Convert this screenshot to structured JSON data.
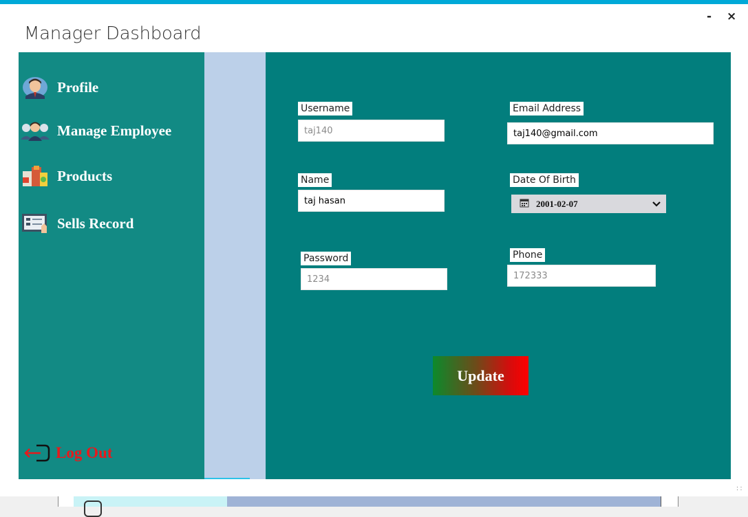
{
  "window": {
    "title": "Manager Dashboard",
    "minimize_label": "-",
    "close_label": "×"
  },
  "sidebar": {
    "items": [
      {
        "label": "Profile",
        "icon": "manager-avatar-icon"
      },
      {
        "label": "Manage Employee",
        "icon": "employees-group-icon"
      },
      {
        "label": "Products",
        "icon": "products-box-icon"
      },
      {
        "label": "Sells Record",
        "icon": "sales-record-icon"
      }
    ],
    "logout": {
      "label": "Log Out",
      "icon": "logout-icon"
    }
  },
  "form": {
    "username": {
      "label": "Username",
      "value": "taj140"
    },
    "email": {
      "label": "Email Address",
      "value": "taj140@gmail.com"
    },
    "name": {
      "label": "Name",
      "value": "taj hasan"
    },
    "dob": {
      "label": "Date Of Birth",
      "value": "2001-02-07"
    },
    "password": {
      "label": "Password",
      "value": "1234"
    },
    "phone": {
      "label": "Phone",
      "value": "172333"
    },
    "update_label": "Update"
  },
  "colors": {
    "accent_top": "#00a9d8",
    "sidebar": "#128a84",
    "main": "#027e7d",
    "strip": "#bcd0e9",
    "logout": "#e8191c"
  }
}
